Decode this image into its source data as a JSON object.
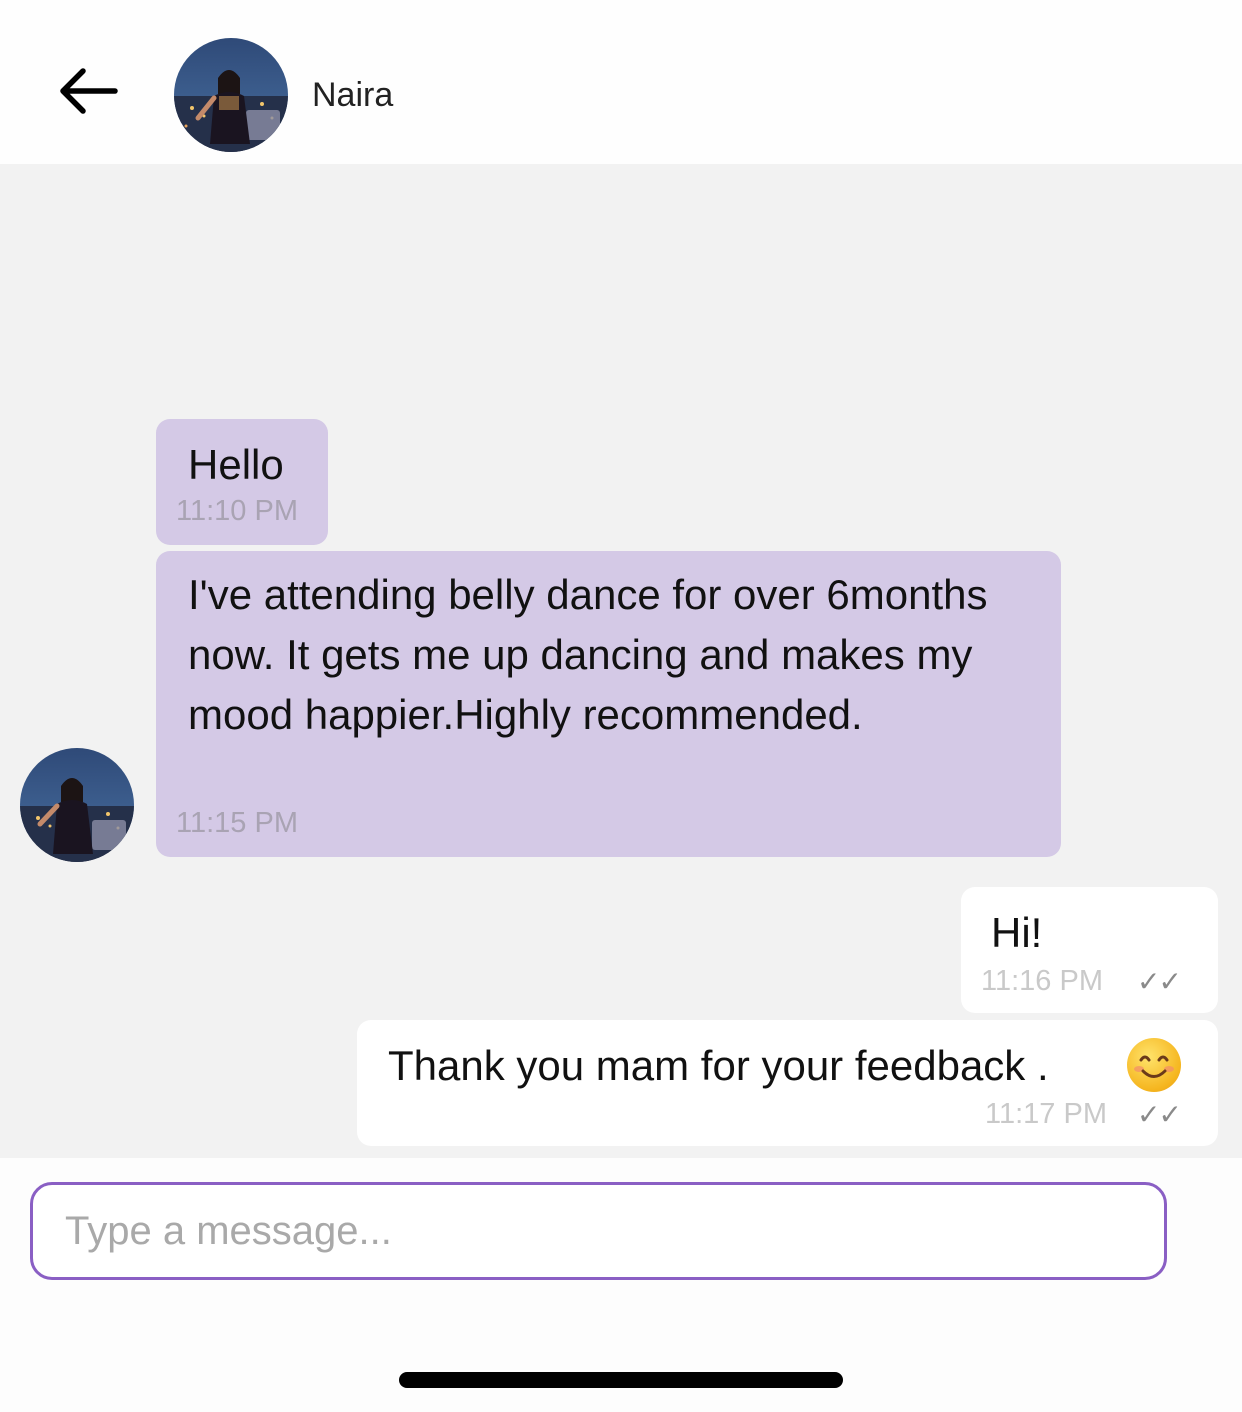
{
  "header": {
    "contact_name": "Naira"
  },
  "icons": {
    "back": "arrow-left-icon",
    "avatar": "profile-photo",
    "read_receipt": "double-check-icon",
    "emoji": "smiling-face-emoji"
  },
  "messages": [
    {
      "direction": "incoming",
      "text": "Hello",
      "time": "11:10 PM"
    },
    {
      "direction": "incoming",
      "text": "I've attending belly dance for over 6months now. It gets me up dancing and makes my mood happier.Highly recommended.",
      "time": "11:15 PM"
    },
    {
      "direction": "outgoing",
      "text": "Hi!",
      "time": "11:16 PM",
      "status": "✓✓"
    },
    {
      "direction": "outgoing",
      "text": "Thank you mam for your feedback .",
      "emoji": "😊",
      "time": "11:17 PM",
      "status": "✓✓"
    }
  ],
  "composer": {
    "placeholder": "Type a message...",
    "value": ""
  },
  "colors": {
    "incoming_bubble": "#d4c9e6",
    "outgoing_bubble": "#ffffff",
    "chat_background": "#f2f2f2",
    "input_border": "#8a5fc4"
  }
}
